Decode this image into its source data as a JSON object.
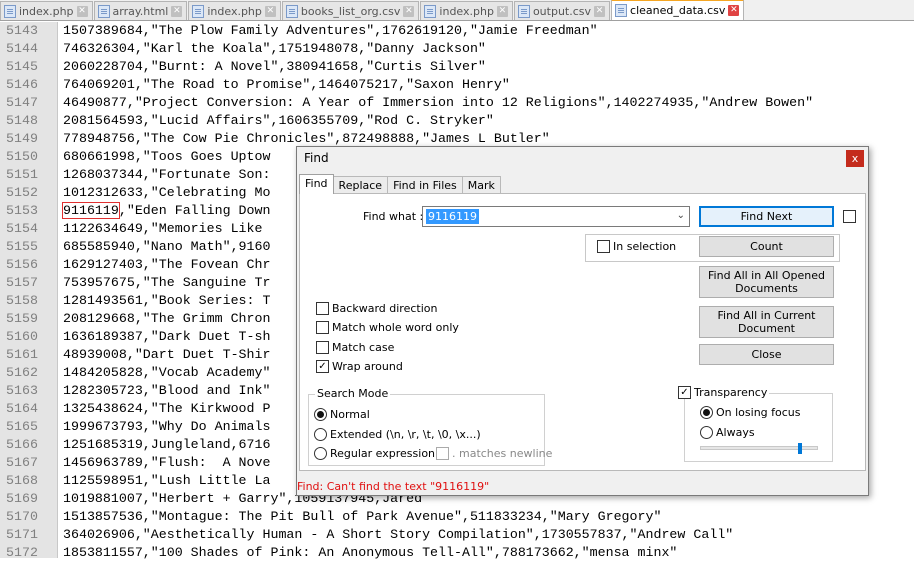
{
  "tabs": [
    {
      "label": "index.php",
      "active": false
    },
    {
      "label": "array.html",
      "active": false
    },
    {
      "label": "index.php",
      "active": false
    },
    {
      "label": "books_list_org.csv",
      "active": false
    },
    {
      "label": "index.php",
      "active": false
    },
    {
      "label": "output.csv",
      "active": false
    },
    {
      "label": "cleaned_data.csv",
      "active": true
    }
  ],
  "editor": {
    "lines": [
      {
        "num": "5143",
        "pre": "1507389684,\"The Plow Family Adventures\",1762619120,\"Jamie Freedman\""
      },
      {
        "num": "5144",
        "pre": "746326304,\"Karl the Koala\",1751948078,\"Danny Jackson\""
      },
      {
        "num": "5145",
        "pre": "2060228704,\"Burnt: A Novel\",380941658,\"Curtis Silver\""
      },
      {
        "num": "5146",
        "pre": "764069201,\"The Road to Promise\",1464075217,\"Saxon Henry\""
      },
      {
        "num": "5147",
        "pre": "46490877,\"Project Conversion: A Year of Immersion into 12 Religions\",1402274935,\"Andrew Bowen\""
      },
      {
        "num": "5148",
        "pre": "2081564593,\"Lucid Affairs\",1606355709,\"Rod C. Stryker\""
      },
      {
        "num": "5149",
        "pre": "778948756,\"The Cow Pie Chronicles\",872498888,\"James L Butler\""
      },
      {
        "num": "5150",
        "pre": "680661998,\"Toos Goes Uptow"
      },
      {
        "num": "5151",
        "pre": "1268037344,\"Fortunate Son:"
      },
      {
        "num": "5152",
        "pre": "1012312633,\"Celebrating Mo"
      },
      {
        "num": "5153",
        "pre": "",
        "match": "9116119",
        "post": ",\"Eden Falling Down"
      },
      {
        "num": "5154",
        "pre": "1122634649,\"Memories Like"
      },
      {
        "num": "5155",
        "pre": "685585940,\"Nano Math\",9160"
      },
      {
        "num": "5156",
        "pre": "1629127403,\"The Fovean Chr"
      },
      {
        "num": "5157",
        "pre": "753957675,\"The Sanguine Tr"
      },
      {
        "num": "5158",
        "pre": "1281493561,\"Book Series: T"
      },
      {
        "num": "5159",
        "pre": "208129668,\"The Grimm Chron"
      },
      {
        "num": "5160",
        "pre": "1636189387,\"Dark Duet T-sh"
      },
      {
        "num": "5161",
        "pre": "48939008,\"Dart Duet T-Shir"
      },
      {
        "num": "5162",
        "pre": "1484205828,\"Vocab Academy\""
      },
      {
        "num": "5163",
        "pre": "1282305723,\"Blood and Ink\""
      },
      {
        "num": "5164",
        "pre": "1325438624,\"The Kirkwood P"
      },
      {
        "num": "5165",
        "pre": "1999673793,\"Why Do Animals"
      },
      {
        "num": "5166",
        "pre": "1251685319,Jungleland,6716"
      },
      {
        "num": "5167",
        "pre": "1456963789,\"Flush:  A Nove"
      },
      {
        "num": "5168",
        "pre": "1125598951,\"Lush Little La                                                emens\""
      },
      {
        "num": "5169",
        "pre": "1019881007,\"Herbert + Garry\",1059137945,Jared"
      },
      {
        "num": "5170",
        "pre": "1513857536,\"Montague: The Pit Bull of Park Avenue\",511833234,\"Mary Gregory\""
      },
      {
        "num": "5171",
        "pre": "364026906,\"Aesthetically Human - A Short Story Compilation\",1730557837,\"Andrew Call\""
      },
      {
        "num": "5172",
        "pre": "1853811557,\"100 Shades of Pink: An Anonymous Tell-All\",788173662,\"mensa minx\""
      }
    ]
  },
  "find_dialog": {
    "title": "Find",
    "close_glyph": "x",
    "tabs": [
      "Find",
      "Replace",
      "Find in Files",
      "Mark"
    ],
    "find_what_label": "Find what :",
    "find_what_value": "9116119",
    "buttons": {
      "find_next": "Find Next",
      "count": "Count",
      "find_all_opened": "Find All in All Opened Documents",
      "find_all_current": "Find All in Current Document",
      "close": "Close"
    },
    "in_selection_label": "In selection",
    "options": [
      {
        "label": "Backward direction",
        "checked": false
      },
      {
        "label": "Match whole word only",
        "checked": false
      },
      {
        "label": "Match case",
        "checked": false
      },
      {
        "label": "Wrap around",
        "checked": true
      }
    ],
    "search_mode": {
      "title": "Search Mode",
      "normal": "Normal",
      "extended": "Extended (\\n, \\r, \\t, \\0, \\x...)",
      "regex": "Regular expression",
      "matches_newline": ". matches newline",
      "selected": "Normal"
    },
    "transparency": {
      "label": "Transparency",
      "checked": true,
      "on_losing_focus": "On losing focus",
      "always": "Always",
      "selected": "On losing focus",
      "level": 0.85
    },
    "status": "Find: Can't find the text \"9116119\""
  },
  "colors": {
    "status_error": "#e01010",
    "active_tab_accent": "#f5a623",
    "selection": "#3399ff",
    "default_button_border": "#0078d7"
  }
}
